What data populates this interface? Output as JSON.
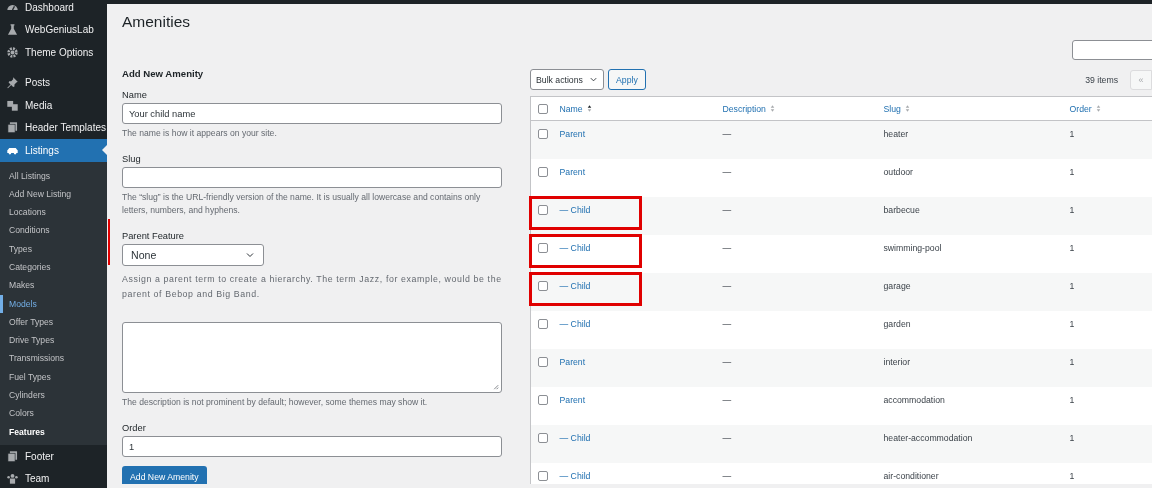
{
  "sidebar": {
    "top_items": [
      {
        "label": "Dashboard",
        "selected": false
      },
      {
        "label": "WebGeniusLab",
        "selected": false
      },
      {
        "label": "Theme Options",
        "selected": false
      },
      {
        "label": "Posts",
        "selected": false
      },
      {
        "label": "Media",
        "selected": false
      },
      {
        "label": "Header Templates",
        "selected": false
      },
      {
        "label": "Listings",
        "selected": true
      }
    ],
    "sub_items": [
      {
        "label": "All Listings",
        "selected": false,
        "hovered": false
      },
      {
        "label": "Add New Listing",
        "selected": false,
        "hovered": false
      },
      {
        "label": "Locations",
        "selected": false,
        "hovered": false
      },
      {
        "label": "Conditions",
        "selected": false,
        "hovered": false
      },
      {
        "label": "Types",
        "selected": false,
        "hovered": false
      },
      {
        "label": "Categories",
        "selected": false,
        "hovered": false
      },
      {
        "label": "Makes",
        "selected": false,
        "hovered": false
      },
      {
        "label": "Models",
        "selected": false,
        "hovered": true
      },
      {
        "label": "Offer Types",
        "selected": false,
        "hovered": false
      },
      {
        "label": "Drive Types",
        "selected": false,
        "hovered": false
      },
      {
        "label": "Transmissions",
        "selected": false,
        "hovered": false
      },
      {
        "label": "Fuel Types",
        "selected": false,
        "hovered": false
      },
      {
        "label": "Cylinders",
        "selected": false,
        "hovered": false
      },
      {
        "label": "Colors",
        "selected": false,
        "hovered": false
      },
      {
        "label": "Features",
        "selected": true,
        "hovered": false
      }
    ],
    "bottom_items": [
      {
        "label": "Footer",
        "selected": false
      },
      {
        "label": "Team",
        "selected": false
      }
    ]
  },
  "page_title": "Amenities",
  "form": {
    "heading": "Add New Amenity",
    "name": {
      "label": "Name",
      "value": "Your child name",
      "help": "The name is how it appears on your site."
    },
    "slug": {
      "label": "Slug",
      "help": "The “slug” is the URL-friendly version of the name. It is usually all lowercase and contains only letters, numbers, and hyphens."
    },
    "parent": {
      "label": "Parent Feature",
      "value": "None",
      "help": "Assign a parent term to create a hierarchy. The term Jazz, for example, would be the parent of Bebop and Big Band.",
      "highlighted": true
    },
    "description": {
      "help": "The description is not prominent by default; however, some themes may show it."
    },
    "order": {
      "label": "Order",
      "value": "1"
    },
    "submit": "Add New Amenity"
  },
  "table": {
    "bulk_actions": "Bulk actions",
    "apply": "Apply",
    "item_count": "39 items",
    "first_page": "«",
    "select_all_checked": false,
    "columns": [
      {
        "label": "Name",
        "sorted": true
      },
      {
        "label": "Description",
        "sorted": false
      },
      {
        "label": "Slug",
        "sorted": false
      },
      {
        "label": "Order",
        "sorted": false
      }
    ],
    "rows": [
      {
        "name": "Parent",
        "description": "—",
        "slug": "heater",
        "order": "1",
        "checked": false,
        "highlighted": false
      },
      {
        "name": "Parent",
        "description": "—",
        "slug": "outdoor",
        "order": "1",
        "checked": false,
        "highlighted": false
      },
      {
        "name": "— Child",
        "description": "—",
        "slug": "barbecue",
        "order": "1",
        "checked": false,
        "highlighted": true
      },
      {
        "name": "— Child",
        "description": "—",
        "slug": "swimming-pool",
        "order": "1",
        "checked": false,
        "highlighted": true
      },
      {
        "name": "— Child",
        "description": "—",
        "slug": "garage",
        "order": "1",
        "checked": false,
        "highlighted": true
      },
      {
        "name": "— Child",
        "description": "—",
        "slug": "garden",
        "order": "1",
        "checked": false,
        "highlighted": false
      },
      {
        "name": "Parent",
        "description": "—",
        "slug": "interior",
        "order": "1",
        "checked": false,
        "highlighted": false
      },
      {
        "name": "Parent",
        "description": "—",
        "slug": "accommodation",
        "order": "1",
        "checked": false,
        "highlighted": false
      },
      {
        "name": "— Child",
        "description": "—",
        "slug": "heater-accommodation",
        "order": "1",
        "checked": false,
        "highlighted": false
      },
      {
        "name": "— Child",
        "description": "—",
        "slug": "air-conditioner",
        "order": "1",
        "checked": false,
        "highlighted": false
      }
    ]
  }
}
